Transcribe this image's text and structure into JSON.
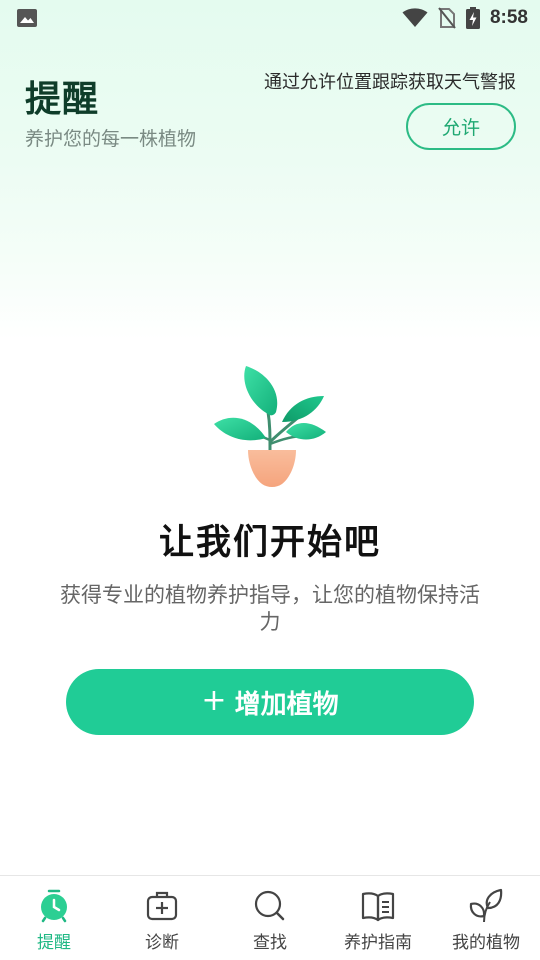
{
  "status_bar": {
    "time": "8:58",
    "icons": [
      "image-icon",
      "wifi-icon",
      "no-sim-icon",
      "battery-charging-icon"
    ]
  },
  "header": {
    "title": "提醒",
    "subtitle": "养护您的每一株植物",
    "weather_prompt": "通过允许位置跟踪获取天气警报",
    "allow_label": "允许"
  },
  "empty_state": {
    "illustration": "potted-plant-icon",
    "title": "让我们开始吧",
    "description": "获得专业的植物养护指导，让您的植物保持活力",
    "add_button_icon": "+",
    "add_button_label": "增加植物"
  },
  "bottom_nav": {
    "items": [
      {
        "label": "提醒",
        "icon": "alarm-clock-icon",
        "active": true
      },
      {
        "label": "诊断",
        "icon": "medical-kit-icon",
        "active": false
      },
      {
        "label": "查找",
        "icon": "search-icon",
        "active": false
      },
      {
        "label": "养护指南",
        "icon": "book-icon",
        "active": false
      },
      {
        "label": "我的植物",
        "icon": "leaves-icon",
        "active": false
      }
    ]
  },
  "colors": {
    "accent": "#20cc96",
    "title": "#0f3d2a",
    "pot": "#f7b08c"
  }
}
